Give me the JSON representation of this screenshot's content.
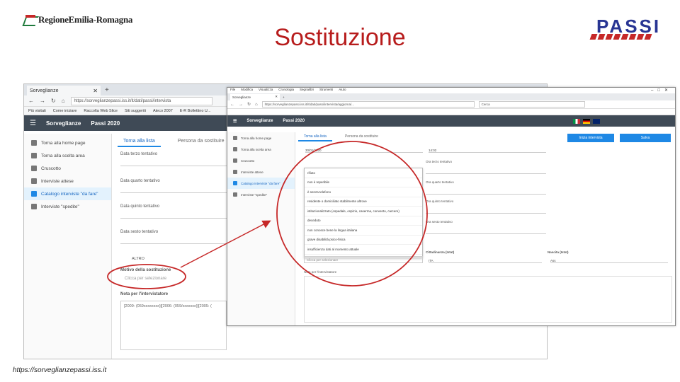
{
  "slide": {
    "title": "Sostituzione",
    "logo_left_text": "RegioneEmilia-Romagna",
    "logo_right_text": "PASSI",
    "footer_url": "https://sorveglianzepassi.iss.it"
  },
  "shot1": {
    "tab_title": "Sorveglianze",
    "url": "https://sorveglianzepassi.iss.it/it/dati/passi/intervista",
    "bookmarks": [
      "Più visitati",
      "Come iniziare",
      "Raccolta Web Slice",
      "Siti suggeriti",
      "Ateco 2007",
      "E-R Bollettino U..."
    ],
    "app_title": "Sorveglianze",
    "app_sub": "Passi 2020",
    "sidebar": [
      {
        "label": "Torna alla home page",
        "active": false
      },
      {
        "label": "Torna alla scelta area",
        "active": false
      },
      {
        "label": "Cruscotto",
        "active": false
      },
      {
        "label": "Interviste attese",
        "active": false
      },
      {
        "label": "Catalogo interviste \"da fare\"",
        "active": true
      },
      {
        "label": "Interviste \"spedite\"",
        "active": false
      }
    ],
    "tabs": [
      "Torna alla lista",
      "Persona da sostituire"
    ],
    "fields": [
      "Data terzo tentativo",
      "Data quarto tentativo",
      "Data quinto tentativo",
      "Data sesto tentativo"
    ],
    "altro_label": "ALTRO",
    "motivo_label": "Motivo della sostituzione",
    "motivo_placeholder": "Clicca per selezionare",
    "note_label": "Nota per l'intervistatore",
    "note_value": "[2009: (059xxxxxxxx)][2006: (059/xxxxxxx)][2005: ("
  },
  "shot2": {
    "menu": [
      "File",
      "Modifica",
      "Visualizza",
      "Cronologia",
      "Segnalibri",
      "Strumenti",
      "Aiuto"
    ],
    "tab_title": "Sorveglianze",
    "url": "https://sorveglianzepassi.iss.it/it/dati/passi/intervista/aggiorna/...",
    "search_placeholder": "Cerca",
    "app_title": "Sorveglianze",
    "app_sub": "Passi 2020",
    "sidebar": [
      {
        "label": "Torna alla home page",
        "active": false
      },
      {
        "label": "Torna alla scelta area",
        "active": false
      },
      {
        "label": "Cruscotto",
        "active": false
      },
      {
        "label": "Interviste attese",
        "active": false
      },
      {
        "label": "Catalogo interviste \"da fare\"",
        "active": true
      },
      {
        "label": "Interviste \"spedite\"",
        "active": false
      }
    ],
    "tabs": [
      "Torna alla lista",
      "Persona da sostituire"
    ],
    "btn_start": "Inizia intervista",
    "btn_save": "Salva",
    "date_value": "30/01/2020",
    "time_value": "14:02",
    "labels_right": [
      "Ora terzo tentativo",
      "Ora quarto tentativo",
      "Ora quinto tentativo",
      "Ora sesto tentativo"
    ],
    "dropdown_options": [
      "rifiuto",
      "non è reperibile",
      "è senza telefono",
      "residente o domiciliato stabilmente altrove",
      "istituzionalizzato (ospedale, ospizio, caserma, convento, carcere)",
      "deceduto",
      "non conosce bene la lingua italiana",
      "grave disabilità psico-fisica",
      "insufficienza dati al momento attuale"
    ],
    "select_placeholder": "Clicca per selezionare",
    "cittadinanza_label": "Cittadinanza (Istat)",
    "cittadinanza_value": "ITA",
    "nascita_label": "Nascita (Istat)",
    "nascita_value": "Ass",
    "note_label": "Nota per l'intervistatore"
  },
  "colors": {
    "title": "#b71c1c",
    "appbar": "#3f4a56",
    "accent": "#1e88e5",
    "annotation": "#c62828"
  }
}
